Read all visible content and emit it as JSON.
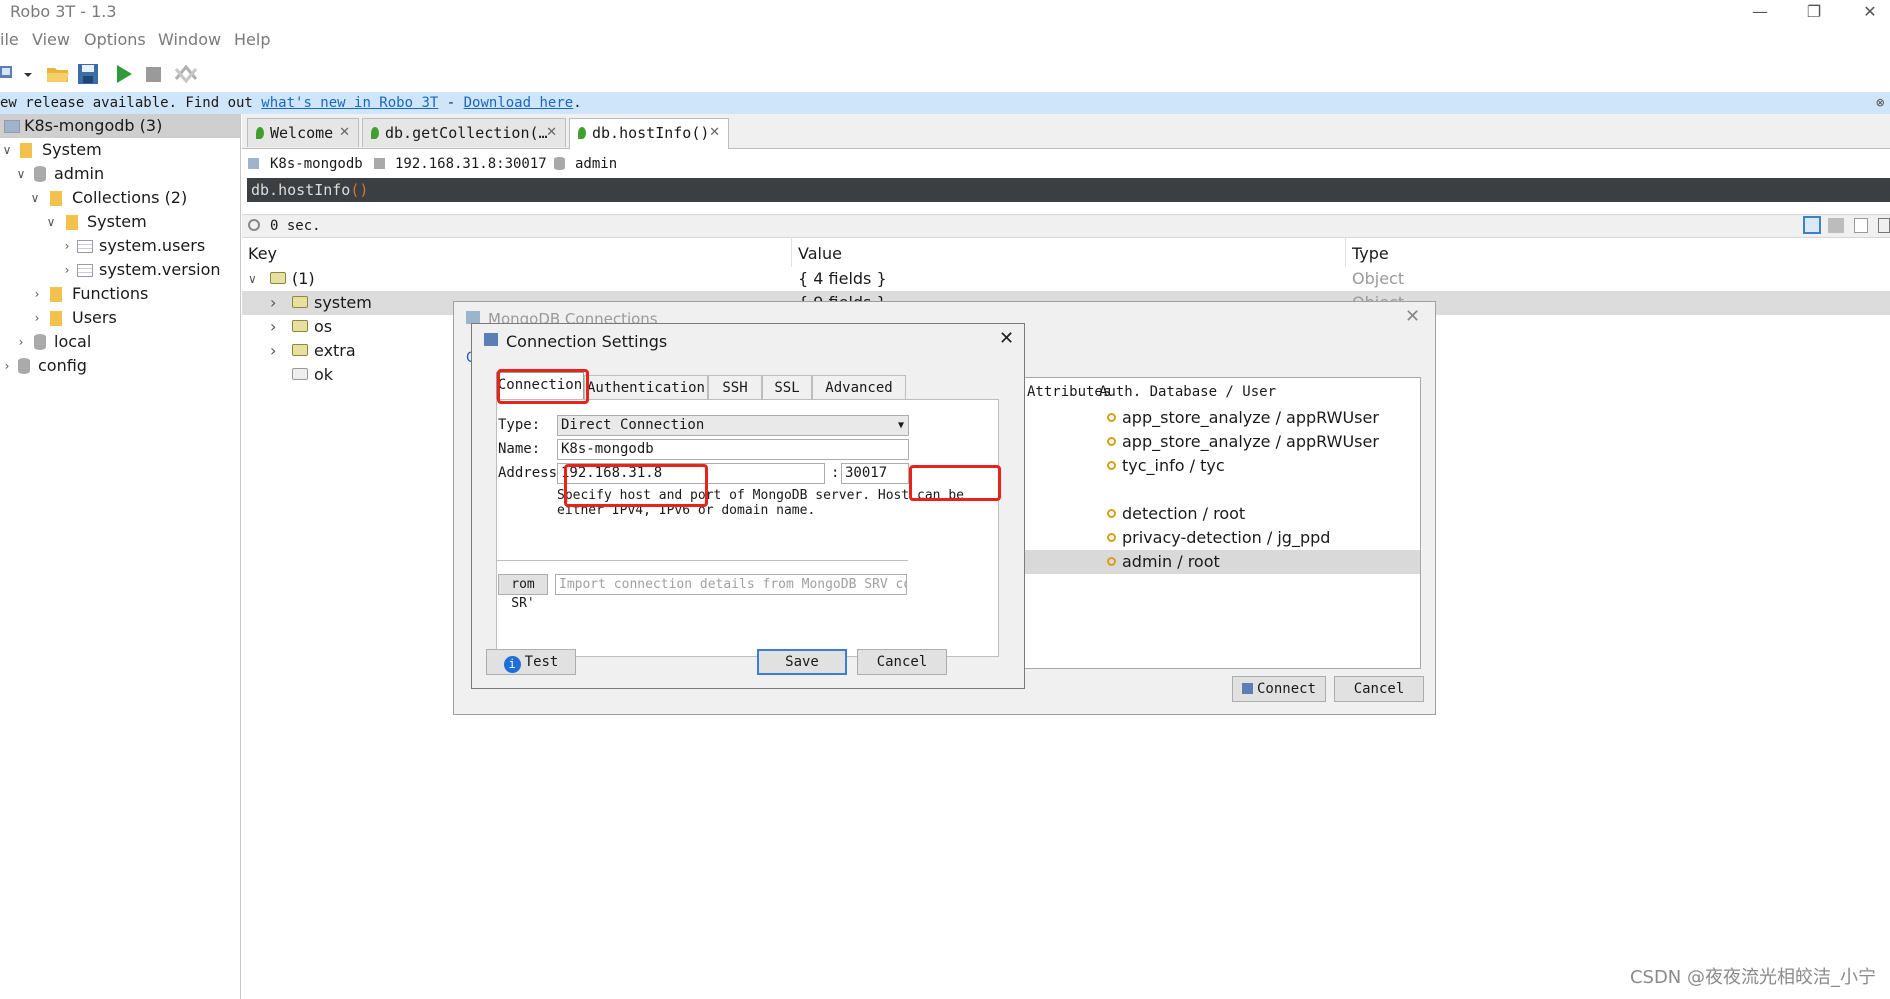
{
  "window": {
    "title": "Robo 3T - 1.3",
    "minimize": "—",
    "restore": "❐",
    "close": "✕"
  },
  "menu": [
    "ile",
    "View",
    "Options",
    "Window",
    "Help"
  ],
  "banner": {
    "prefix": "ew release available. Find out ",
    "link1": "what's new in Robo 3T",
    "sep": " - ",
    "link2": "Download here",
    "suffix": "."
  },
  "sidebar": {
    "connection": "K8s-mongodb (3)",
    "items": [
      "System",
      "admin",
      "Collections (2)",
      "System",
      "system.users",
      "system.version",
      "Functions",
      "Users",
      "local",
      "config"
    ]
  },
  "tabs": [
    "Welcome",
    "db.getCollection(…",
    "db.hostInfo()"
  ],
  "conn_info": {
    "server": "K8s-mongodb",
    "address": "192.168.31.8:30017",
    "db": "admin"
  },
  "query": {
    "text": "db.hostInfo",
    "parens": "()"
  },
  "exec_time": "0 sec.",
  "results": {
    "headers": [
      "Key",
      "Value",
      "Type"
    ],
    "rows": [
      {
        "key": "(1)",
        "value": "{ 4 fields }",
        "type": "Object"
      },
      {
        "key": "system",
        "value": "{ 9 fields }",
        "type": "Object"
      },
      {
        "key": "os",
        "value": "",
        "type": ""
      },
      {
        "key": "extra",
        "value": "",
        "type": ""
      },
      {
        "key": "ok",
        "value": "",
        "type": ""
      }
    ]
  },
  "mongo_connections": {
    "title": "MongoDB Connections",
    "list_headers": [
      "Attributes",
      "Auth. Database / User"
    ],
    "entries": [
      "app_store_analyze / appRWUser",
      "app_store_analyze / appRWUser",
      "tyc_info / tyc",
      "detection / root",
      "privacy-detection / jg_ppd",
      "admin / root"
    ],
    "connect": "Connect",
    "cancel": "Cancel"
  },
  "connection_settings": {
    "title": "Connection Settings",
    "tabs": [
      "Connection",
      "Authentication",
      "SSH",
      "SSL",
      "Advanced"
    ],
    "type_label": "Type:",
    "type_value": "Direct Connection",
    "name_label": "Name:",
    "name_value": "K8s-mongodb",
    "address_label": "Address:",
    "host": "192.168.31.8",
    "colon": ":",
    "port": "30017",
    "help_line1": "Specify host and port of MongoDB server. Host can be",
    "help_line2": "either IPv4, IPv6 or domain name.",
    "srv_button": "rom SR'",
    "srv_placeholder": "Import connection details from MongoDB SRV connect…",
    "test": "Test",
    "save": "Save",
    "cancel": "Cancel"
  },
  "watermark": "CSDN @夜夜流光相皎洁_小宁",
  "colors": {
    "highlight": "#e8241a",
    "banner": "#cfe6fa",
    "query_bg": "#3c3f41"
  }
}
